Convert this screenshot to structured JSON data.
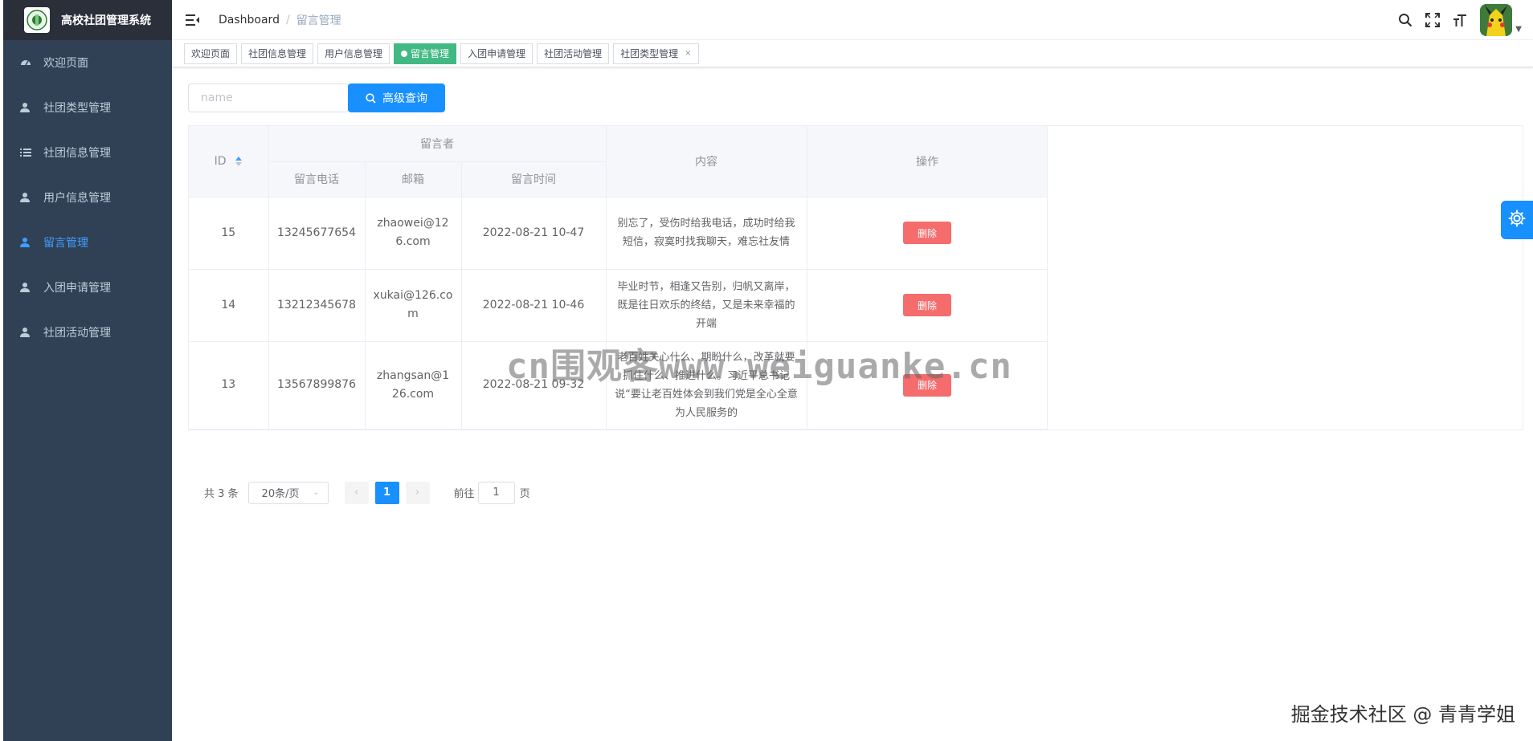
{
  "app": {
    "title": "高校社团管理系统"
  },
  "sidebar": {
    "items": [
      {
        "label": "欢迎页面",
        "icon": "dashboard-icon",
        "active": false
      },
      {
        "label": "社团类型管理",
        "icon": "user-icon",
        "active": false
      },
      {
        "label": "社团信息管理",
        "icon": "list-icon",
        "active": false
      },
      {
        "label": "用户信息管理",
        "icon": "user-icon",
        "active": false
      },
      {
        "label": "留言管理",
        "icon": "user-icon",
        "active": true
      },
      {
        "label": "入团申请管理",
        "icon": "user-icon",
        "active": false
      },
      {
        "label": "社团活动管理",
        "icon": "user-icon",
        "active": false
      }
    ]
  },
  "breadcrumb": {
    "home": "Dashboard",
    "separator": "/",
    "current": "留言管理"
  },
  "tags": [
    {
      "label": "欢迎页面",
      "active": false
    },
    {
      "label": "社团信息管理",
      "active": false
    },
    {
      "label": "用户信息管理",
      "active": false
    },
    {
      "label": "留言管理",
      "active": true
    },
    {
      "label": "入团申请管理",
      "active": false
    },
    {
      "label": "社团活动管理",
      "active": false
    },
    {
      "label": "社团类型管理",
      "active": false,
      "closable": true
    }
  ],
  "search": {
    "placeholder": "name",
    "button_label": "高级查询"
  },
  "table": {
    "headers": {
      "id": "ID",
      "group": "留言者",
      "phone": "留言电话",
      "email": "邮箱",
      "time": "留言时间",
      "content": "内容",
      "actions": "操作"
    },
    "rows": [
      {
        "id": "15",
        "phone": "13245677654",
        "email": "zhaowei@126.com",
        "time": "2022-08-21 10-47",
        "content": "别忘了，受伤时给我电话，成功时给我短信，寂寞时找我聊天，难忘社友情",
        "action": "删除"
      },
      {
        "id": "14",
        "phone": "13212345678",
        "email": "xukai@126.com",
        "time": "2022-08-21 10-46",
        "content": "毕业时节，相逢又告别，归帆又离岸，既是往日欢乐的终结，又是未来幸福的开端",
        "action": "删除"
      },
      {
        "id": "13",
        "phone": "13567899876",
        "email": "zhangsan@126.com",
        "time": "2022-08-21 09-32",
        "content": "老百姓关心什么、期盼什么，改革就要抓住什么、推进什么。习近平总书记说“要让老百姓体会到我们党是全心全意为人民服务的",
        "action": "删除"
      }
    ]
  },
  "pagination": {
    "total_text": "共 3 条",
    "page_size": "20条/页",
    "current_page": "1",
    "goto_prefix": "前往",
    "goto_value": "1",
    "goto_suffix": "页"
  },
  "watermarks": {
    "center": "cn围观客www.weiguanke.cn",
    "corner": "掘金技术社区 @ 青青学姐"
  },
  "colors": {
    "sidebar_bg": "#304156",
    "accent": "#1890ff",
    "active_tag": "#42b983",
    "danger": "#f56c6c"
  }
}
